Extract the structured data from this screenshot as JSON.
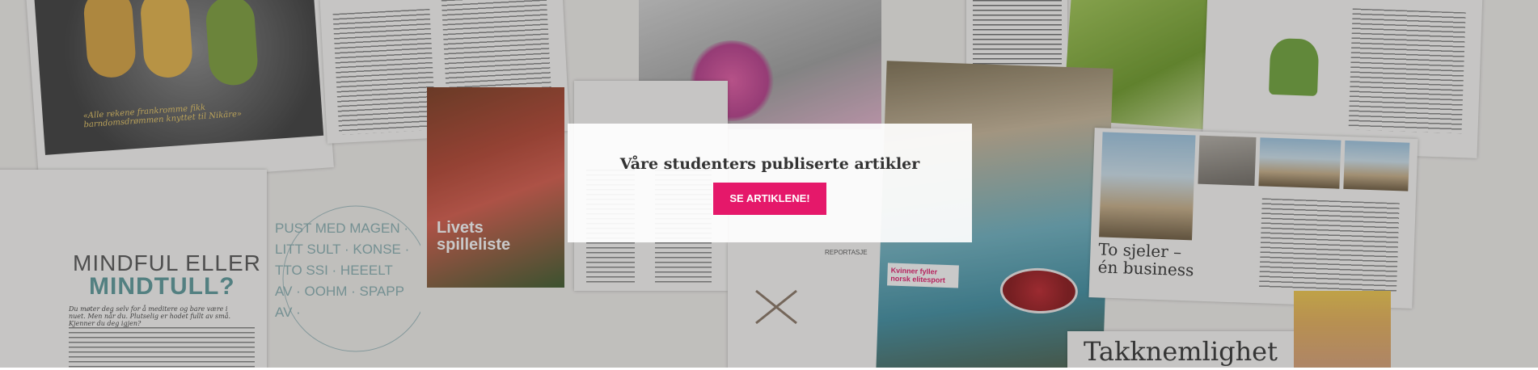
{
  "hero": {
    "title": "Våre studenters publiserte artikler",
    "button_label": "SE ARTIKLENE!"
  },
  "collage": {
    "mindful_line1": "MINDFUL ELLER",
    "mindful_line2": "MINDTULL?",
    "mindful_sub": "Du møter deg selv for å meditere og bare være i nuet. Men når du. Plutselig er hodet fullt av små. Kjenner du deg igjen?",
    "livets_title": "Livets",
    "livets_title2": "spilleliste",
    "sjeler_title": "To sjeler –",
    "sjeler_title2": "én business",
    "kvinner_badge": "Kvinner fyller norsk elitesport",
    "reportage": "REPORTASJE",
    "quote": "«Alle rekene frankromme fikk barndomsdrømmen knyttet til Nikäre»",
    "bottom_heading": "Takknemlighet",
    "circle_text": "PUST MED MAGEN · LITT SULT · KONSE · TTO SSI · HEEELT AV · OOHM · SPAPP AV ·",
    "brand_color": "#e5186a"
  }
}
